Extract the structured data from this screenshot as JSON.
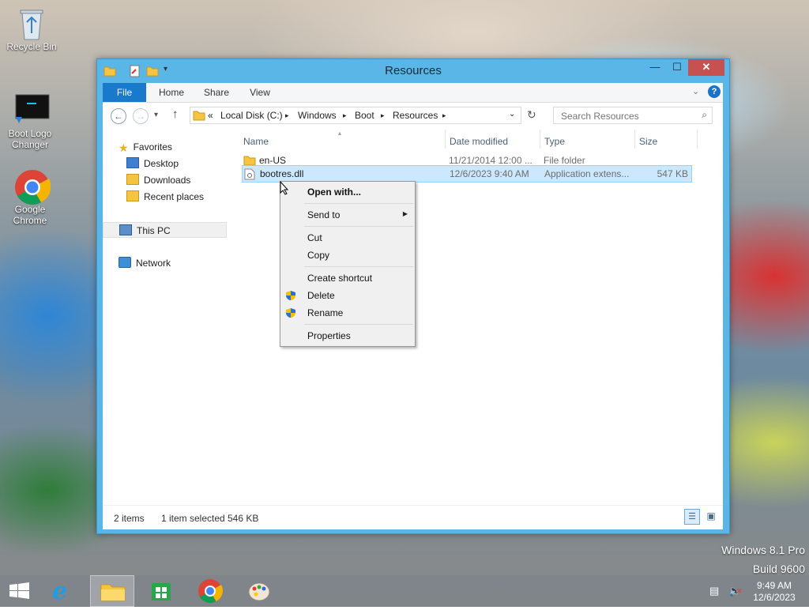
{
  "desktop": {
    "icons": [
      {
        "label": "Recycle Bin"
      },
      {
        "label": "Boot Logo Changer"
      },
      {
        "label": "Google Chrome"
      }
    ],
    "watermark": {
      "line1": "Windows 8.1 Pro",
      "line2": "Build 9600"
    }
  },
  "window": {
    "title": "Resources",
    "controls": {
      "minimize": "—",
      "maximize": "☐",
      "close": "✕"
    },
    "ribbon_tabs": [
      "File",
      "Home",
      "Share",
      "View"
    ],
    "address": {
      "overflow": "«",
      "crumbs": [
        "Local Disk (C:)",
        "Windows",
        "Boot",
        "Resources"
      ]
    },
    "search": {
      "placeholder": "Search Resources"
    },
    "navpane": {
      "favorites": "Favorites",
      "favorites_items": [
        "Desktop",
        "Downloads",
        "Recent places"
      ],
      "this_pc": "This PC",
      "network": "Network"
    },
    "columns": {
      "name": "Name",
      "date": "Date modified",
      "type": "Type",
      "size": "Size"
    },
    "files": [
      {
        "name": "en-US",
        "date": "11/21/2014 12:00 ...",
        "type": "File folder",
        "size": ""
      },
      {
        "name": "bootres.dll",
        "date": "12/6/2023 9:40 AM",
        "type": "Application extens...",
        "size": "547 KB"
      }
    ],
    "status": {
      "items": "2 items",
      "selected": "1 item selected",
      "selected_size": "546 KB"
    }
  },
  "context_menu": {
    "items": [
      "Open with...",
      "Send to",
      "Cut",
      "Copy",
      "Create shortcut",
      "Delete",
      "Rename",
      "Properties"
    ]
  },
  "taskbar": {
    "clock_time": "9:49 AM",
    "clock_date": "12/6/2023"
  },
  "colors": {
    "window_frame": "#5ab6e6",
    "file_tab": "#1979ca",
    "selection": "#cce8ff",
    "close_button": "#c75050"
  }
}
